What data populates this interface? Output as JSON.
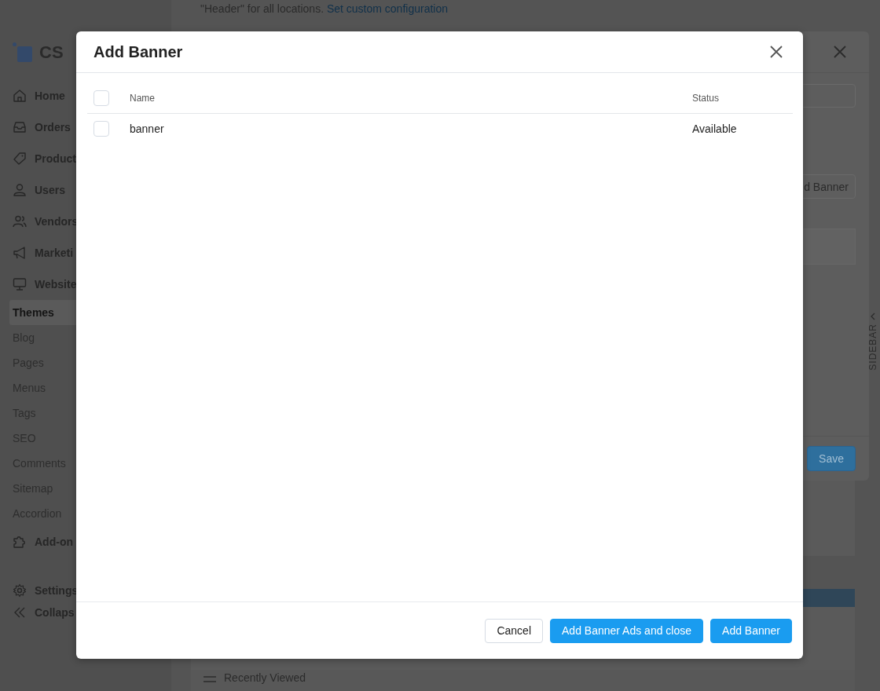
{
  "page_notice": {
    "text": "\"Header\" for all locations.",
    "link": "Set custom configuration"
  },
  "sidebar": {
    "logo": "CS",
    "items": [
      {
        "label": "Home",
        "kind": "section",
        "selected": false
      },
      {
        "label": "Orders",
        "kind": "section",
        "selected": false
      },
      {
        "label": "Product",
        "kind": "section",
        "selected": false
      },
      {
        "label": "Users",
        "kind": "section",
        "selected": false
      },
      {
        "label": "Vendors",
        "kind": "section",
        "selected": false
      },
      {
        "label": "Marketi",
        "kind": "section",
        "selected": false
      },
      {
        "label": "Website",
        "kind": "section",
        "selected": false
      },
      {
        "label": "Themes",
        "kind": "sub",
        "selected": true
      },
      {
        "label": "Blog",
        "kind": "sub",
        "selected": false
      },
      {
        "label": "Pages",
        "kind": "sub",
        "selected": false
      },
      {
        "label": "Menus",
        "kind": "sub",
        "selected": false
      },
      {
        "label": "Tags",
        "kind": "sub",
        "selected": false
      },
      {
        "label": "SEO",
        "kind": "sub",
        "selected": false
      },
      {
        "label": "Comments",
        "kind": "sub",
        "selected": false
      },
      {
        "label": "Sitemap",
        "kind": "sub",
        "selected": false
      },
      {
        "label": "Accordion",
        "kind": "sub",
        "selected": false
      },
      {
        "label": "Add-on",
        "kind": "section",
        "selected": false
      }
    ],
    "footer": [
      {
        "label": "Settings"
      },
      {
        "label": "Collaps"
      }
    ]
  },
  "back_dialog": {
    "button_fragment": "d Banner",
    "save_button": "Save"
  },
  "sidebar_toggle": "SIDEBAR",
  "recently_viewed": "Recently Viewed",
  "modal": {
    "title": "Add Banner",
    "select_all_checked": false,
    "columns": [
      "Name",
      "Status"
    ],
    "rows": [
      {
        "name": "banner",
        "status": "Available",
        "checked": false
      }
    ],
    "buttons": [
      {
        "label": "Cancel",
        "kind": "secondary"
      },
      {
        "label": "Add Banner Ads and close",
        "kind": "primary"
      },
      {
        "label": "Add Banner",
        "kind": "primary"
      }
    ]
  }
}
